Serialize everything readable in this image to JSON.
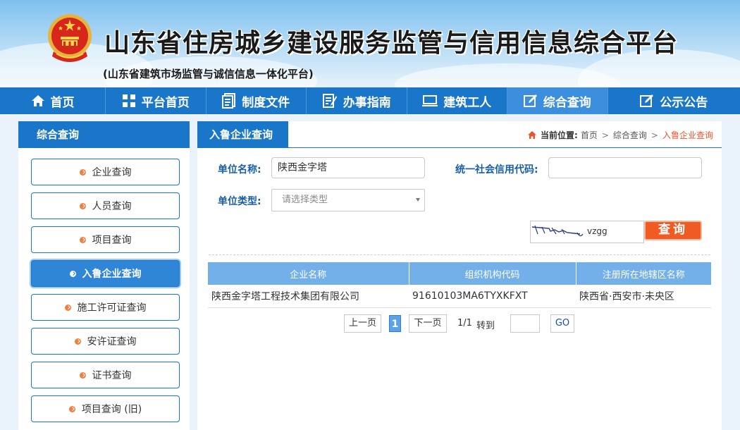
{
  "header": {
    "title": "山东省住房城乡建设服务监管与信用信息综合平台",
    "subtitle": "(山东省建筑市场监管与诚信信息一体化平台)"
  },
  "nav": {
    "items": [
      {
        "label": "首页",
        "icon": "home-icon"
      },
      {
        "label": "平台首页",
        "icon": "grid-icon"
      },
      {
        "label": "制度文件",
        "icon": "document-icon"
      },
      {
        "label": "办事指南",
        "icon": "guide-icon"
      },
      {
        "label": "建筑工人",
        "icon": "monitor-icon"
      },
      {
        "label": "综合查询",
        "icon": "edit-icon",
        "active": true
      },
      {
        "label": "公示公告",
        "icon": "edit-icon"
      }
    ]
  },
  "sidebar": {
    "title": "综合查询",
    "items": [
      {
        "label": "企业查询"
      },
      {
        "label": "人员查询"
      },
      {
        "label": "项目查询"
      },
      {
        "label": "入鲁企业查询",
        "active": true
      },
      {
        "label": "施工许可证查询"
      },
      {
        "label": "安许证查询"
      },
      {
        "label": "证书查询"
      },
      {
        "label": "项目查询 (旧)"
      }
    ]
  },
  "main": {
    "tab_title": "入鲁企业查询",
    "breadcrumb": {
      "prefix": "当前位置:",
      "items": [
        "首页",
        "综合查询",
        "入鲁企业查询"
      ]
    },
    "form": {
      "unit_name_label": "单位名称:",
      "unit_name_value": "陕西金字塔",
      "credit_code_label": "统一社会信用代码:",
      "credit_code_value": "",
      "unit_type_label": "单位类型:",
      "unit_type_placeholder": "请选择类型",
      "captcha_text": "vzgg",
      "query_button": "查询"
    },
    "table": {
      "headers": [
        "企业名称",
        "组织机构代码",
        "注册所在地辖区名称"
      ],
      "rows": [
        [
          "陕西金字塔工程技术集团有限公司",
          "91610103MA6TYXKFXT",
          "陕西省·西安市·未央区"
        ]
      ]
    },
    "pager": {
      "prev": "上一页",
      "current_page": "1",
      "next": "下一页",
      "page_info": "1/1",
      "goto_label": "转到",
      "go": "GO"
    }
  },
  "colors": {
    "brand_blue": "#1a76c8",
    "accent_orange": "#f05a23",
    "table_header": "#73b0ea"
  }
}
